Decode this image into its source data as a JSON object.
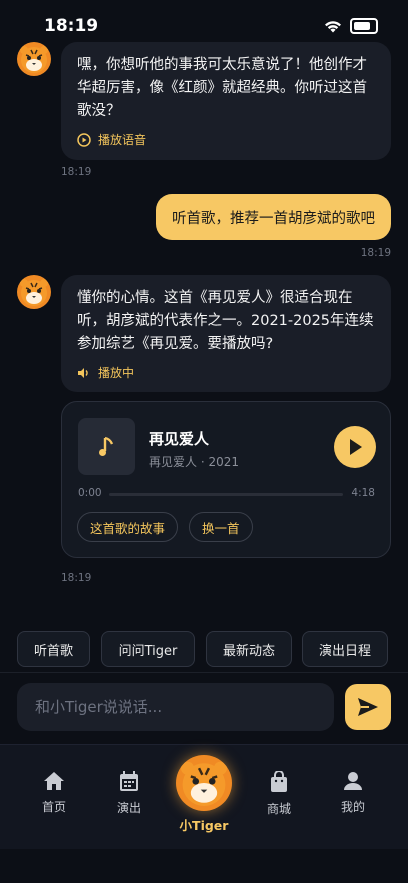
{
  "status_bar": {
    "time": "18:19"
  },
  "messages": {
    "m1": {
      "text": "嘿，你想听他的事我可太乐意说了！他创作才华超厉害，像《红颜》就超经典。你听过这首歌没？",
      "audio_label": "播放语音",
      "time": "18:19"
    },
    "m2": {
      "text": "听首歌，推荐一首胡彦斌的歌吧",
      "time": "18:19"
    },
    "m3": {
      "text": "懂你的心情。这首《再见爱人》很适合现在听，胡彦斌的代表作之一。2021-2025年连续参加综艺《再见爱。要播放吗?",
      "audio_label": "播放中"
    }
  },
  "music_card": {
    "title": "再见爱人",
    "subtitle": "再见爱人 · 2021",
    "time_current": "0:00",
    "time_total": "4:18",
    "progress": 0,
    "story_button": "这首歌的故事",
    "switch_button": "换一首",
    "time": "18:19"
  },
  "quick_actions": [
    "听首歌",
    "问问Tiger",
    "最新动态",
    "演出日程"
  ],
  "input": {
    "placeholder": "和小Tiger说说话..."
  },
  "tabs": {
    "home": "首页",
    "shows": "演出",
    "center": "小Tiger",
    "shop": "商城",
    "me": "我的"
  },
  "icons": [
    "wifi-icon",
    "battery-icon",
    "tiger-avatar-icon",
    "play-circle-icon",
    "speaker-icon",
    "music-note-icon",
    "play-icon",
    "send-icon",
    "home-icon",
    "calendar-icon",
    "shopping-bag-icon",
    "person-icon"
  ],
  "colors": {
    "accent": "#f7c864",
    "background": "#0c0f16",
    "bubble": "#1a1e28"
  }
}
